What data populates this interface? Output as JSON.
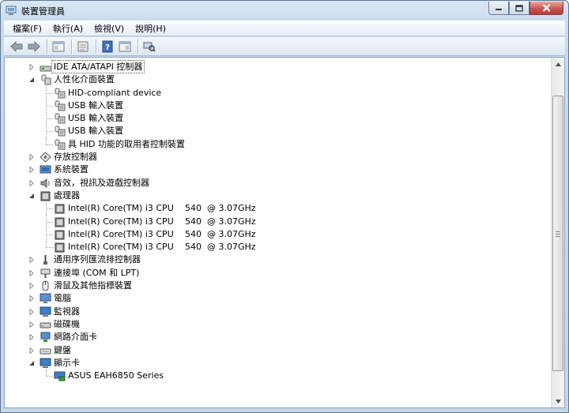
{
  "window": {
    "title": "裝置管理員",
    "caption_buttons": [
      "minimize-icon",
      "maximize-icon",
      "close-icon"
    ]
  },
  "menu": [
    {
      "label": "檔案(F)"
    },
    {
      "label": "執行(A)"
    },
    {
      "label": "檢視(V)"
    },
    {
      "label": "說明(H)"
    }
  ],
  "toolbar": {
    "buttons": [
      "back-icon",
      "forward-icon",
      "properties-icon",
      "console-tree-icon",
      "help-icon",
      "action-pane-icon",
      "scan-hardware-icon"
    ]
  },
  "tree": [
    {
      "level": 1,
      "exp": "collapsed",
      "icon": "ide-controller-icon",
      "label": "IDE ATA/ATAPI 控制器",
      "selected": true
    },
    {
      "level": 1,
      "exp": "expanded",
      "icon": "hid-icon",
      "label": "人性化介面裝置"
    },
    {
      "level": 2,
      "icon": "hid-device-icon",
      "label": "HID-compliant device"
    },
    {
      "level": 2,
      "icon": "hid-device-icon",
      "label": "USB 輸入裝置"
    },
    {
      "level": 2,
      "icon": "hid-device-icon",
      "label": "USB 輸入裝置"
    },
    {
      "level": 2,
      "icon": "hid-device-icon",
      "label": "USB 輸入裝置"
    },
    {
      "level": 2,
      "icon": "hid-device-icon",
      "label": "具 HID 功能的取用者控制裝置"
    },
    {
      "level": 1,
      "exp": "collapsed",
      "icon": "storage-controller-icon",
      "label": "存放控制器"
    },
    {
      "level": 1,
      "exp": "collapsed",
      "icon": "system-device-icon",
      "label": "系統裝置"
    },
    {
      "level": 1,
      "exp": "collapsed",
      "icon": "sound-icon",
      "label": "音效，視訊及遊戲控制器"
    },
    {
      "level": 1,
      "exp": "expanded",
      "icon": "processor-icon",
      "label": "處理器"
    },
    {
      "level": 2,
      "icon": "cpu-icon",
      "label": "Intel(R) Core(TM) i3 CPU",
      "label2": "540  @ 3.07GHz"
    },
    {
      "level": 2,
      "icon": "cpu-icon",
      "label": "Intel(R) Core(TM) i3 CPU",
      "label2": "540  @ 3.07GHz"
    },
    {
      "level": 2,
      "icon": "cpu-icon",
      "label": "Intel(R) Core(TM) i3 CPU",
      "label2": "540  @ 3.07GHz"
    },
    {
      "level": 2,
      "icon": "cpu-icon",
      "label": "Intel(R) Core(TM) i3 CPU",
      "label2": "540  @ 3.07GHz"
    },
    {
      "level": 1,
      "exp": "collapsed",
      "icon": "usb-controller-icon",
      "label": "通用序列匯流排控制器"
    },
    {
      "level": 1,
      "exp": "collapsed",
      "icon": "port-icon",
      "label": "連接埠 (COM 和 LPT)"
    },
    {
      "level": 1,
      "exp": "collapsed",
      "icon": "mouse-icon",
      "label": "滑鼠及其他指標裝置"
    },
    {
      "level": 1,
      "exp": "collapsed",
      "icon": "computer-icon",
      "label": "電腦"
    },
    {
      "level": 1,
      "exp": "collapsed",
      "icon": "monitor-icon",
      "label": "監視器"
    },
    {
      "level": 1,
      "exp": "collapsed",
      "icon": "disk-drive-icon",
      "label": "磁碟機"
    },
    {
      "level": 1,
      "exp": "collapsed",
      "icon": "network-adapter-icon",
      "label": "網路介面卡"
    },
    {
      "level": 1,
      "exp": "collapsed",
      "icon": "keyboard-icon",
      "label": "鍵盤"
    },
    {
      "level": 1,
      "exp": "expanded",
      "icon": "display-adapter-icon",
      "label": "顯示卡"
    },
    {
      "level": 2,
      "icon": "display-device-icon",
      "label": "ASUS EAH6850 Series"
    }
  ],
  "scrollbar": {
    "position": 0.03
  }
}
